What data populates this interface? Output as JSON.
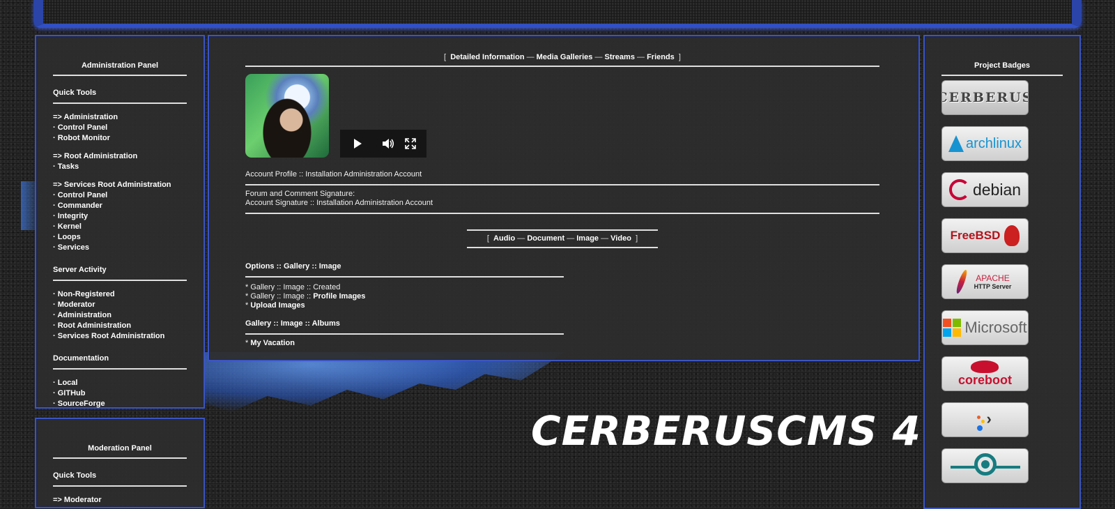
{
  "admin_panel": {
    "title": "Administration Panel",
    "quick_tools": {
      "title": "Quick Tools",
      "groups": [
        {
          "head": "=> Administration",
          "items": [
            "Control Panel",
            "Robot Monitor"
          ]
        },
        {
          "head": "=> Root Administration",
          "items": [
            "Tasks"
          ]
        },
        {
          "head": "=> Services Root Administration",
          "items": [
            "Control Panel",
            "Commander",
            "Integrity",
            "Kernel",
            "Loops",
            "Services"
          ]
        }
      ]
    },
    "server_activity": {
      "title": "Server Activity",
      "items": [
        "Non-Registered",
        "Moderator",
        "Administration",
        "Root Administration",
        "Services Root Administration"
      ]
    },
    "documentation": {
      "title": "Documentation",
      "items": [
        "Local",
        "GITHub",
        "SourceForge"
      ]
    }
  },
  "mod_panel": {
    "title": "Moderation Panel",
    "quick_tools_title": "Quick Tools",
    "first_item": "=> Moderator"
  },
  "main": {
    "tabs": {
      "open": "[",
      "close": "]",
      "sep": "—",
      "items": [
        "Detailed Information",
        "Media Galleries",
        "Streams",
        "Friends"
      ]
    },
    "account_profile": "Account Profile :: Installation Administration Account",
    "signature_label": "Forum and Comment Signature:",
    "signature_value": "Account Signature :: Installation Administration Account",
    "media_tabs": {
      "open": "[",
      "close": "]",
      "sep": "—",
      "items": [
        "Audio",
        "Document",
        "Image",
        "Video"
      ]
    },
    "options": {
      "title": "Options :: Gallery :: Image",
      "line1": "* Gallery :: Image :: Created",
      "line2_prefix": "* Gallery :: Image :: ",
      "line2_link": "Profile Images",
      "line3_prefix": "* ",
      "line3_link": "Upload Images"
    },
    "albums": {
      "title": "Gallery :: Image :: Albums",
      "line_prefix": "* ",
      "line_link": "My Vacation"
    }
  },
  "wordmark": "CERBERUSCMS 4",
  "badges": {
    "title": "Project Badges",
    "items": [
      {
        "name": "cerberus-badge",
        "label": "CERBERUS"
      },
      {
        "name": "archlinux-badge",
        "label": "archlinux"
      },
      {
        "name": "debian-badge",
        "label": "debian"
      },
      {
        "name": "freebsd-badge",
        "label": "FreeBSD"
      },
      {
        "name": "apache-badge",
        "label": "APACHE",
        "sub": "HTTP Server"
      },
      {
        "name": "microsoft-badge",
        "label": "Microsoft"
      },
      {
        "name": "coreboot-badge",
        "label": "coreboot"
      },
      {
        "name": "arrow-badge",
        "label": ""
      },
      {
        "name": "lineageos-badge",
        "label": ""
      }
    ]
  },
  "colors": {
    "panel_border": "#3b55c4",
    "panel_bg": "#2d2d2d",
    "text": "#ffffff"
  }
}
